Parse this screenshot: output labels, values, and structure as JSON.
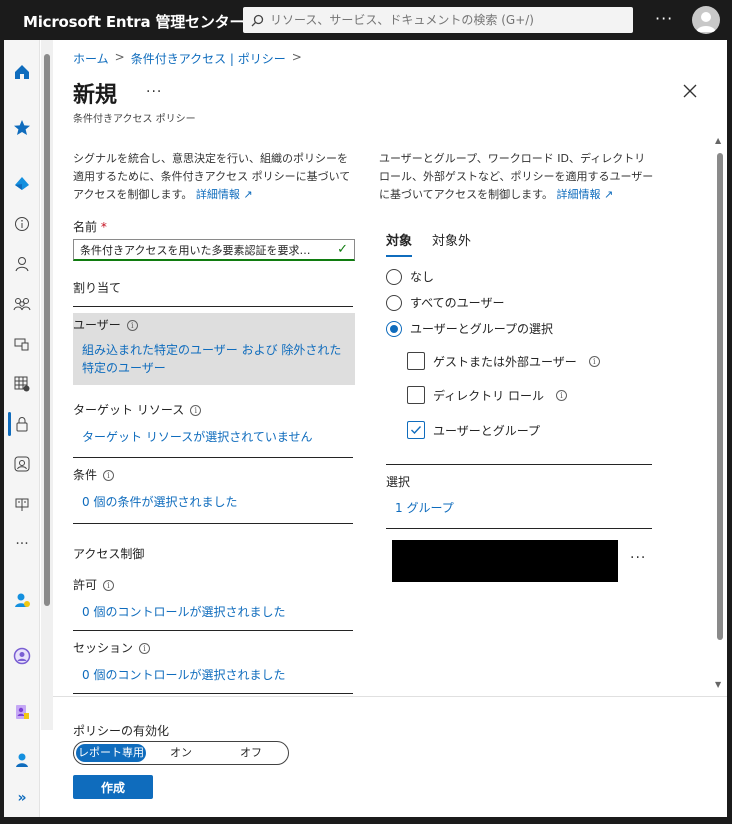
{
  "app": {
    "brand": "Microsoft Entra 管理センター",
    "search_placeholder": "リソース、サービス、ドキュメントの検索 (G+/)",
    "more": "···"
  },
  "breadcrumb": {
    "items": [
      "ホーム",
      "条件付きアクセス | ポリシー"
    ],
    "sep": ">"
  },
  "page": {
    "title": "新規",
    "title_more": "···",
    "subtitle": "条件付きアクセス ポリシー"
  },
  "left": {
    "description": "シグナルを統合し、意思決定を行い、組織のポリシーを適用するために、条件付きアクセス ポリシーに基づいてアクセスを制御します。",
    "learn_more": "詳細情報",
    "name_label": "名前",
    "name_required": "*",
    "name_value": "条件付きアクセスを用いた多要素認証を要求…",
    "assignments": "割り当て",
    "users_label": "ユーザー",
    "users_value": "組み込まれた特定のユーザー および 除外された特定のユーザー",
    "target_label": "ターゲット リソース",
    "target_value": "ターゲット リソースが選択されていません",
    "conditions_label": "条件",
    "conditions_value": "0 個の条件が選択されました",
    "access_controls": "アクセス制御",
    "grant_label": "許可",
    "grant_value": "0 個のコントロールが選択されました",
    "session_label": "セッション",
    "session_value": "0 個のコントロールが選択されました"
  },
  "right": {
    "description": "ユーザーとグループ、ワークロード ID、ディレクトリ ロール、外部ゲストなど、ポリシーを適用するユーザーに基づいてアクセスを制御します。",
    "learn_more": "詳細情報",
    "tabs": [
      "対象",
      "対象外"
    ],
    "radio_options": [
      "なし",
      "すべてのユーザー",
      "ユーザーとグループの選択"
    ],
    "selected_radio": 2,
    "checkboxes": [
      {
        "label": "ゲストまたは外部ユーザー",
        "checked": false,
        "info": true
      },
      {
        "label": "ディレクトリ ロール",
        "checked": false,
        "info": true
      },
      {
        "label": "ユーザーとグループ",
        "checked": true,
        "info": false
      }
    ],
    "select_label": "選択",
    "select_value": "1 グループ",
    "item_more": "···"
  },
  "footer": {
    "policy_label": "ポリシーの有効化",
    "options": [
      "レポート専用",
      "オン",
      "オフ"
    ],
    "selected": "レポート専用",
    "create": "作成"
  },
  "colors": {
    "accent": "#0f6cbd",
    "success": "#107c10",
    "topbar": "#1b1b1b"
  }
}
